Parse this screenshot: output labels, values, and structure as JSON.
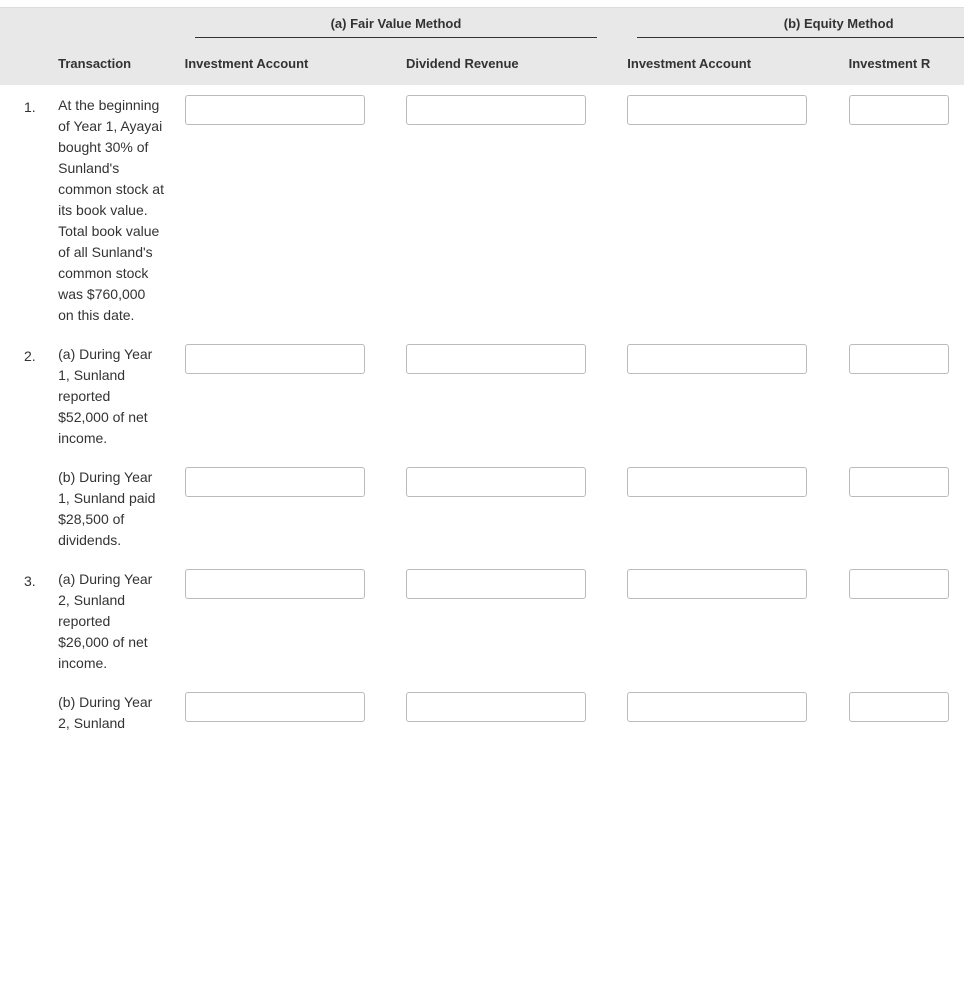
{
  "headers": {
    "method_a": "(a) Fair Value Method",
    "method_b": "(b) Equity Method",
    "transaction": "Transaction",
    "investment_account_a": "Investment Account",
    "dividend_revenue": "Dividend Revenue",
    "investment_account_b": "Investment Account",
    "investment_r": "Investment R"
  },
  "rows": [
    {
      "num": "1.",
      "text": "At the beginning of Year 1, Ayayai bought 30% of Sunland's common stock at its book value. Total book value of all Sunland's common stock was $760,000 on this date.",
      "inputs": {
        "a1": "",
        "a2": "",
        "b1": "",
        "b2": ""
      }
    },
    {
      "num": "2.",
      "text": "(a) During Year 1, Sunland reported $52,000 of net income.",
      "inputs": {
        "a1": "",
        "a2": "",
        "b1": "",
        "b2": ""
      }
    },
    {
      "num": "",
      "text": "(b) During Year 1, Sunland paid $28,500 of dividends.",
      "inputs": {
        "a1": "",
        "a2": "",
        "b1": "",
        "b2": ""
      }
    },
    {
      "num": "3.",
      "text": "(a) During Year 2, Sunland reported $26,000 of net income.",
      "inputs": {
        "a1": "",
        "a2": "",
        "b1": "",
        "b2": ""
      }
    },
    {
      "num": "",
      "text": "(b) During Year 2, Sunland",
      "inputs": {
        "a1": "",
        "a2": "",
        "b1": "",
        "b2": ""
      }
    }
  ]
}
